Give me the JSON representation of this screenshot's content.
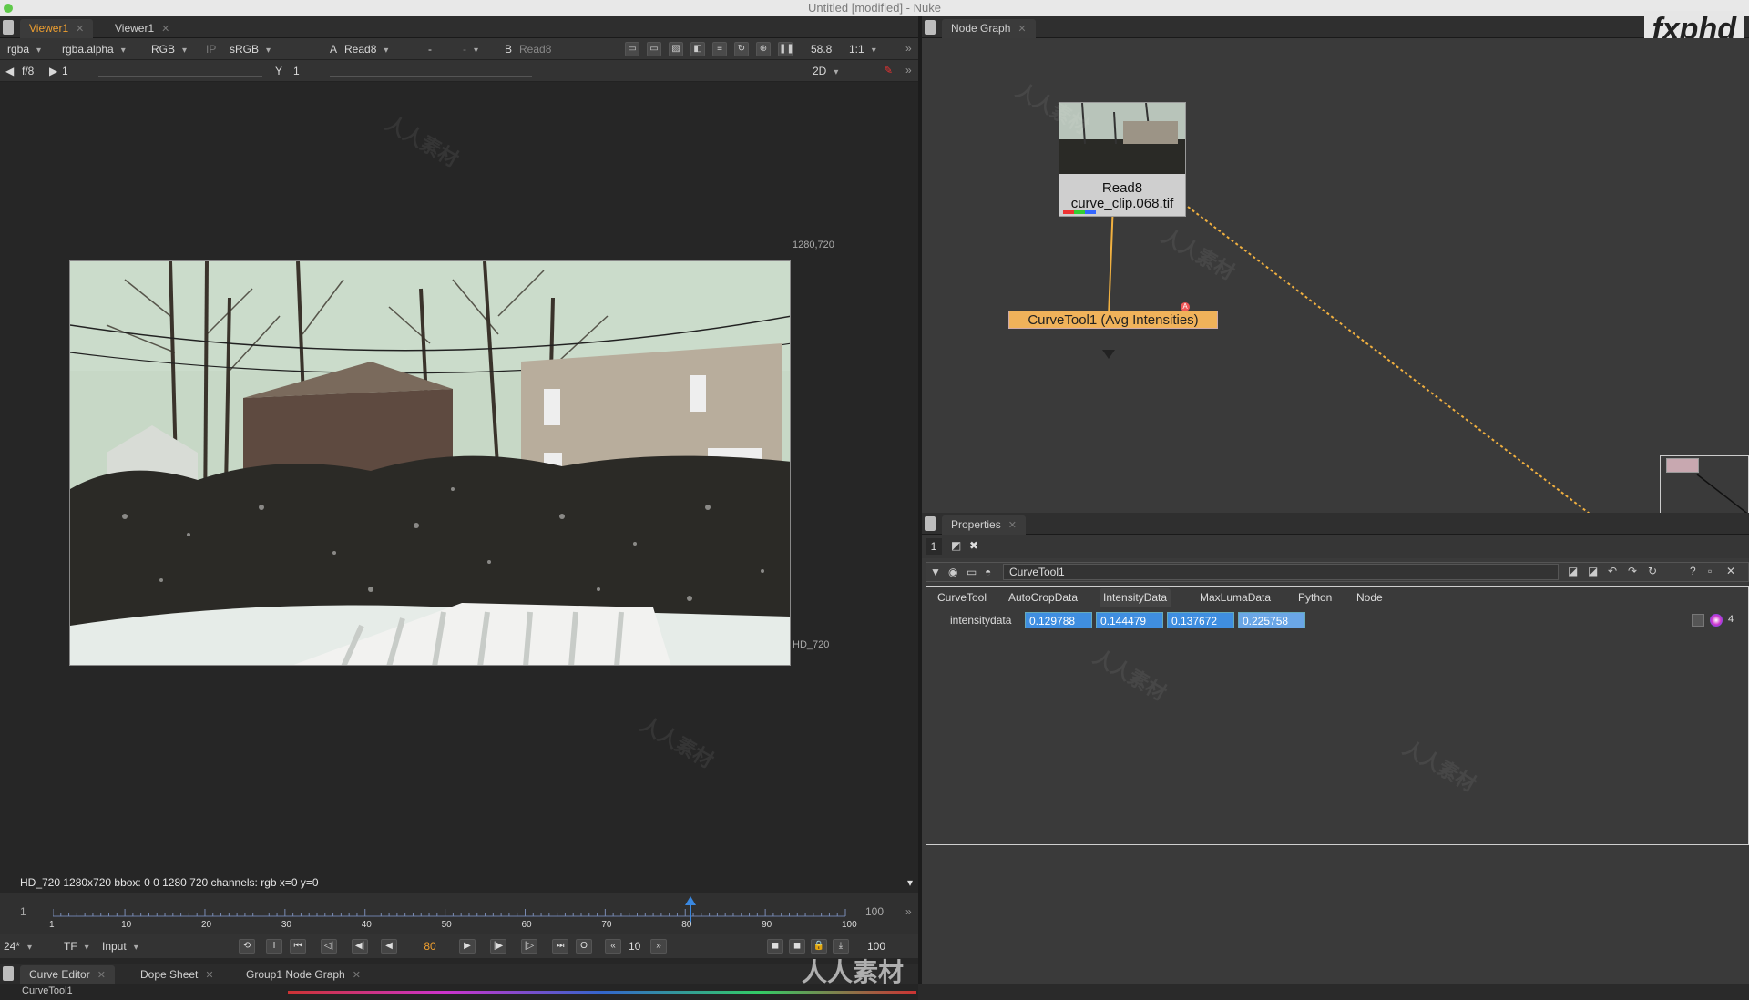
{
  "window": {
    "title": "Untitled [modified] - Nuke"
  },
  "viewer": {
    "tabs": [
      "Viewer1",
      "Viewer1"
    ],
    "toolbar1": {
      "channels": "rgba",
      "alpha": "rgba.alpha",
      "display": "RGB",
      "ip": "IP",
      "lut": "sRGB",
      "a_label": "A",
      "a_input": "Read8",
      "dash1": "-",
      "dash2": "-",
      "b_label": "B",
      "b_input": "Read8",
      "fps": "58.8",
      "zoom": "1:1"
    },
    "toolbar2": {
      "fstop": "f/8",
      "gain": "1",
      "y_label": "Y",
      "gamma": "1",
      "view_mode": "2D"
    },
    "format_top": "1280,720",
    "format_bottom": "HD_720",
    "status": "HD_720 1280x720  bbox: 0 0 1280 720 channels: rgb   x=0 y=0"
  },
  "timeline": {
    "start_frame": "1",
    "end_frame": "100",
    "ticks": [
      "1",
      "10",
      "20",
      "30",
      "40",
      "50",
      "60",
      "70",
      "80",
      "90",
      "100"
    ],
    "current_frame": "80",
    "fps": "24*",
    "tf": "TF",
    "input": "Input",
    "increment": "10",
    "out_frame": "100"
  },
  "bottom_panel": {
    "tabs": [
      "Curve Editor",
      "Dope Sheet",
      "Group1 Node Graph"
    ],
    "list_item": "CurveTool1"
  },
  "node_graph": {
    "tab": "Node Graph",
    "read_node": {
      "name": "Read8",
      "file": "curve_clip.068.tif"
    },
    "curve_node": {
      "label": "CurveTool1 (Avg Intensities)"
    }
  },
  "properties": {
    "tab": "Properties",
    "max_panels": "1",
    "node_name": "CurveTool1",
    "tabs": [
      "CurveTool",
      "AutoCropData",
      "IntensityData",
      "MaxLumaData",
      "Python",
      "Node"
    ],
    "active_tab": "IntensityData",
    "intensity_label": "intensitydata",
    "intensity_values": [
      "0.129788",
      "0.144479",
      "0.137672",
      "0.225758"
    ],
    "channel_count": "4"
  },
  "branding": {
    "logo": "fxphd",
    "watermark": "人人素材"
  }
}
